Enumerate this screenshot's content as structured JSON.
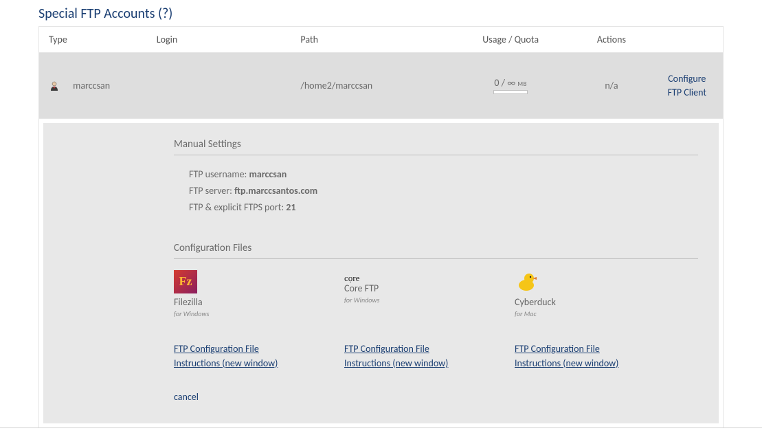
{
  "section": {
    "title": "Special FTP Accounts",
    "help": "(?)"
  },
  "table": {
    "headers": {
      "type": "Type",
      "login": "Login",
      "path": "Path",
      "usage": "Usage / Quota",
      "actions": "Actions"
    },
    "rows": [
      {
        "login": "marccsan",
        "path": "/home2/marccsan",
        "usage_used": "0",
        "usage_sep": " / ",
        "usage_limit": "∞",
        "usage_unit": "MB",
        "actions_text": "n/a",
        "config_line1": "Configure",
        "config_line2": "FTP Client"
      }
    ]
  },
  "details": {
    "manual_heading": "Manual Settings",
    "username_label": "FTP username: ",
    "username_value": "marccsan",
    "server_label": "FTP server: ",
    "server_value": "ftp.marccsantos.com",
    "port_label": "FTP & explicit FTPS port: ",
    "port_value": "21",
    "config_files_heading": "Configuration Files",
    "clients": [
      {
        "name": "Filezilla",
        "os": "for Windows",
        "link_line1": "FTP Configuration File",
        "link_line2": "Instructions (new window)"
      },
      {
        "name": "Core FTP",
        "os": "for Windows",
        "core_label": "cọre",
        "link_line1": "FTP Configuration File",
        "link_line2": "Instructions (new window)"
      },
      {
        "name": "Cyberduck",
        "os": "for Mac",
        "link_line1": "FTP Configuration File",
        "link_line2": "Instructions (new window)"
      }
    ],
    "cancel": "cancel"
  }
}
